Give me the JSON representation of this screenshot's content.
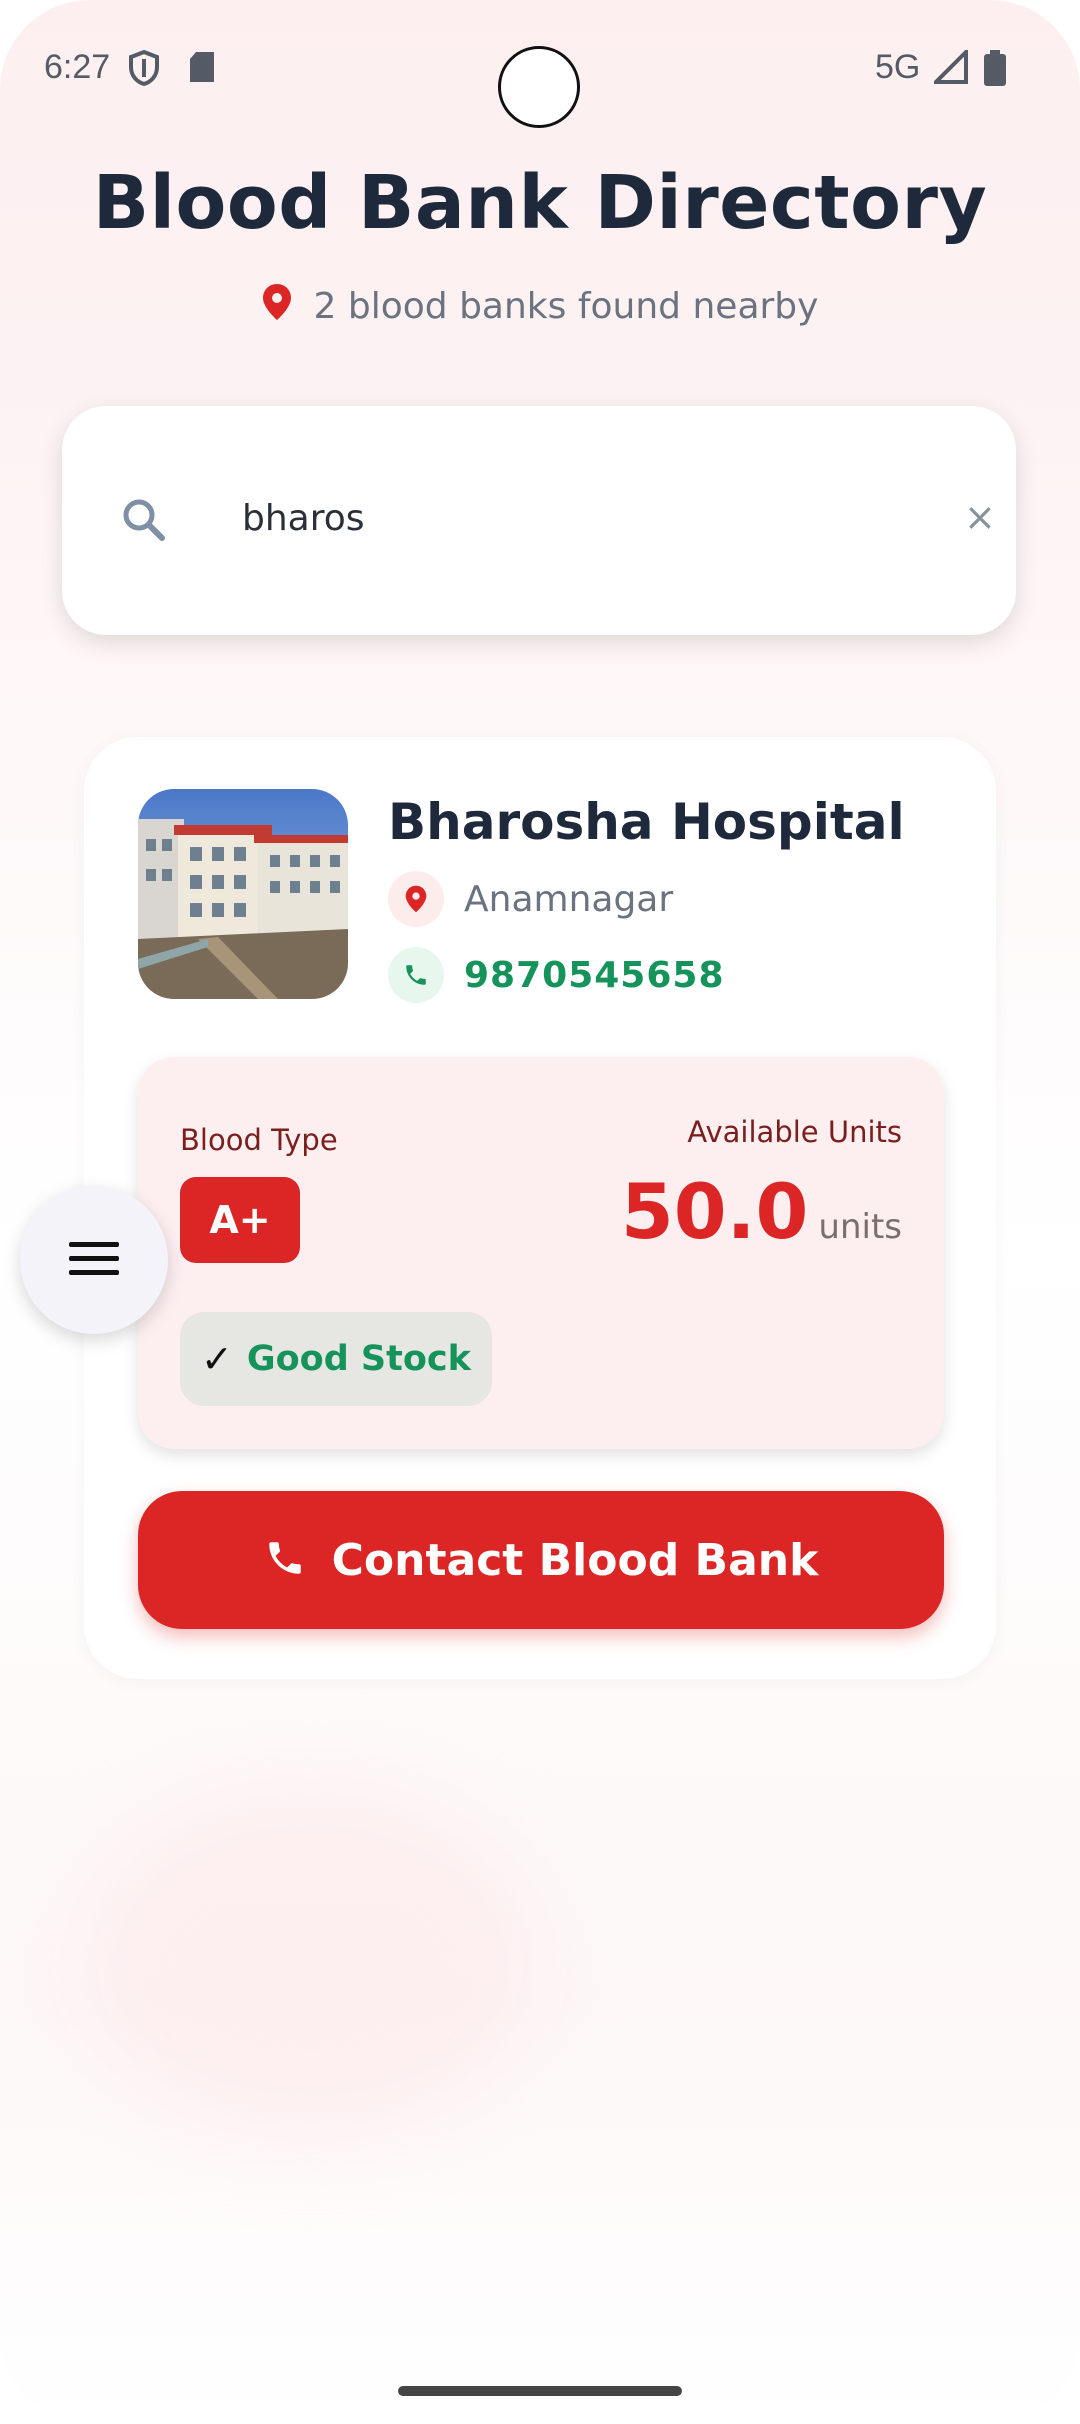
{
  "status_bar": {
    "time": "6:27",
    "network": "5G"
  },
  "header": {
    "title": "Blood Bank Directory",
    "subtitle": "2 blood banks found nearby"
  },
  "search": {
    "value": "bharos",
    "clear_symbol": "×"
  },
  "bank": {
    "name": "Bharosha Hospital",
    "location": "Anamnagar",
    "phone": "9870545658",
    "blood_type_label": "Blood Type",
    "blood_type": "A+",
    "available_label": "Available Units",
    "available_units": "50.0",
    "units_label": "units",
    "stock_status": "Good Stock",
    "stock_check": "✓",
    "contact_label": "Contact Blood Bank"
  },
  "colors": {
    "primary_red": "#dc2626",
    "title": "#1e2a3b",
    "green": "#15935a"
  },
  "icons": [
    "shield-icon",
    "sd-card-icon",
    "signal-icon",
    "battery-icon",
    "location-pin-icon",
    "search-icon",
    "clear-icon",
    "phone-icon",
    "menu-icon"
  ]
}
